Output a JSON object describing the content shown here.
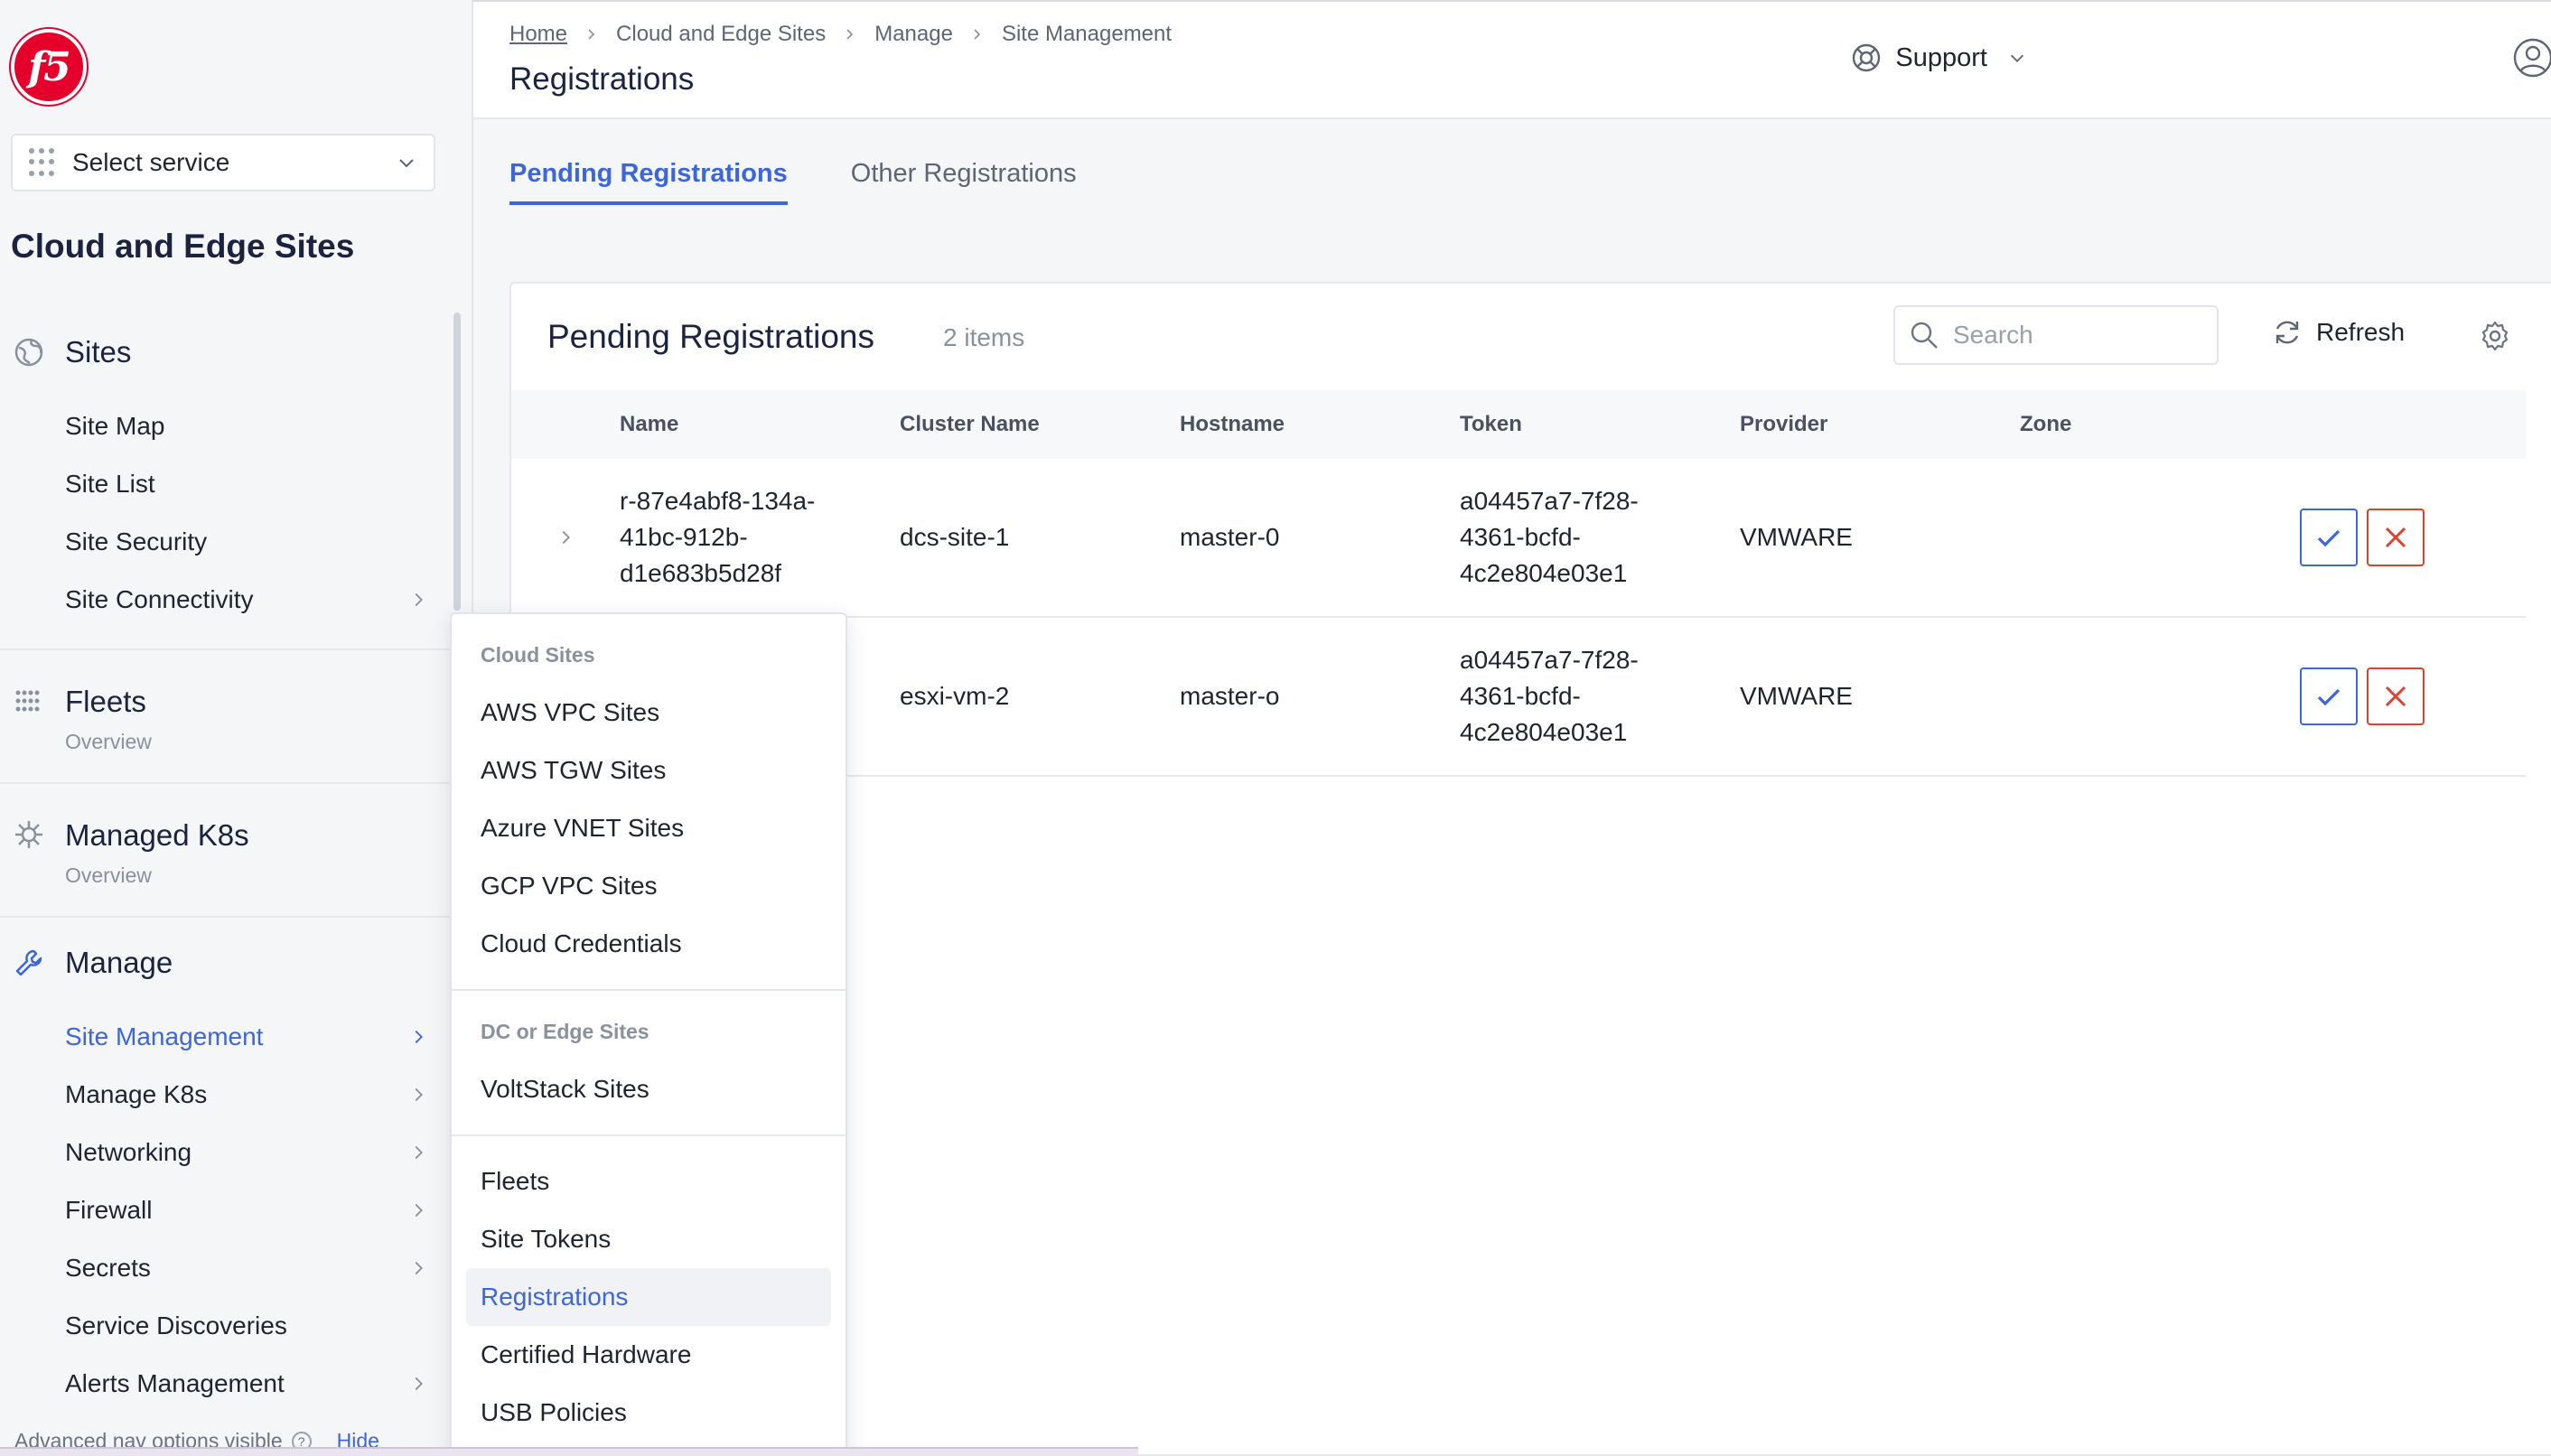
{
  "sidebar": {
    "logo_text": "f5",
    "service_select": {
      "label": "Select service"
    },
    "app_title": "Cloud and Edge Sites",
    "groups": {
      "sites": {
        "title": "Sites",
        "items": [
          "Site Map",
          "Site List",
          "Site Security",
          "Site Connectivity"
        ]
      },
      "fleets": {
        "title": "Fleets",
        "subtitle": "Overview"
      },
      "managed_k8s": {
        "title": "Managed K8s",
        "subtitle": "Overview"
      },
      "manage": {
        "title": "Manage",
        "items": [
          "Site Management",
          "Manage K8s",
          "Networking",
          "Firewall",
          "Secrets",
          "Service Discoveries",
          "Alerts Management"
        ],
        "active_item": "Site Management"
      }
    },
    "footer": {
      "text": "Advanced nav options visible",
      "hide_label": "Hide"
    }
  },
  "header": {
    "breadcrumb": [
      "Home",
      "Cloud and Edge Sites",
      "Manage",
      "Site Management"
    ],
    "page_title": "Registrations",
    "support_label": "Support"
  },
  "tabs": [
    "Pending Registrations",
    "Other Registrations"
  ],
  "active_tab": "Pending Registrations",
  "card": {
    "title": "Pending Registrations",
    "item_count": "2 items",
    "search_placeholder": "Search",
    "refresh_label": "Refresh"
  },
  "table": {
    "columns": [
      "Name",
      "Cluster Name",
      "Hostname",
      "Token",
      "Provider",
      "Zone"
    ],
    "rows": [
      {
        "name": "r-87e4abf8-134a-41bc-912b-d1e683b5d28f",
        "cluster": "dcs-site-1",
        "hostname": "master-0",
        "token": "a04457a7-7f28-4361-bcfd-4c2e804e03e1",
        "provider": "VMWARE",
        "zone": ""
      },
      {
        "name": "",
        "cluster": "esxi-vm-2",
        "hostname": "master-o",
        "token": "a04457a7-7f28-4361-bcfd-4c2e804e03e1",
        "provider": "VMWARE",
        "zone": ""
      }
    ]
  },
  "flyout": {
    "sections": [
      {
        "heading": "Cloud Sites",
        "items": [
          "AWS VPC Sites",
          "AWS TGW Sites",
          "Azure VNET Sites",
          "GCP VPC Sites",
          "Cloud Credentials"
        ]
      },
      {
        "heading": "DC or Edge Sites",
        "items": [
          "VoltStack Sites"
        ]
      },
      {
        "heading": "",
        "items": [
          "Fleets",
          "Site Tokens",
          "Registrations",
          "Certified Hardware",
          "USB Policies"
        ]
      }
    ],
    "selected_item": "Registrations"
  },
  "colors": {
    "accent": "#3d66d8",
    "reject": "#d9432f",
    "brand": "#e4002b"
  }
}
